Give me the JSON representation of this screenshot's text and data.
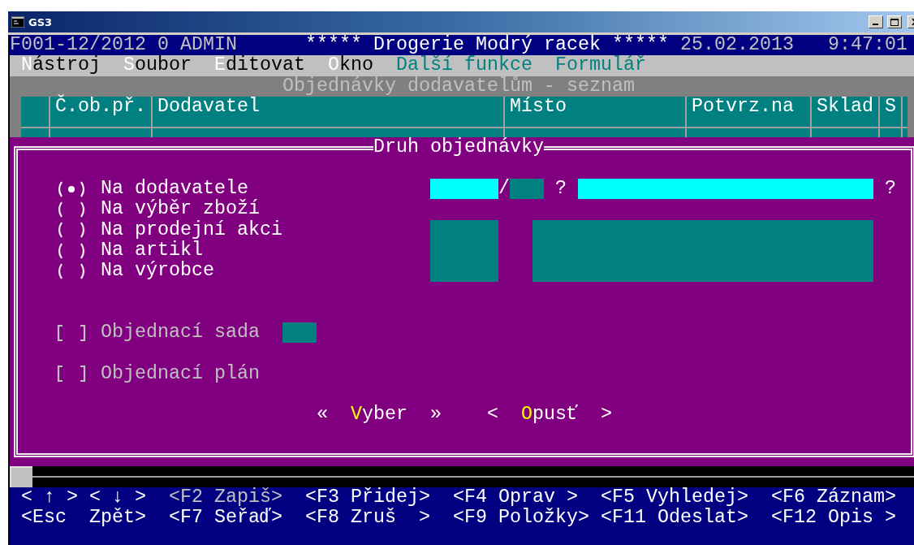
{
  "window": {
    "title": "GS3"
  },
  "header": {
    "session": "F001-12/2012 0 ADMIN",
    "company": "***** Drogerie Modrý racek *****",
    "date": "25.02.2013",
    "time": "9:47:01"
  },
  "menu": [
    {
      "label": "Nástroj",
      "disabled": false
    },
    {
      "label": "Soubor",
      "disabled": false
    },
    {
      "label": "Editovat",
      "disabled": false
    },
    {
      "label": "Okno",
      "disabled": false
    },
    {
      "label": "Další funkce",
      "disabled": true
    },
    {
      "label": "Formulář",
      "disabled": true
    }
  ],
  "screen_title": "Objednávky dodavatelům - seznam",
  "table": {
    "columns": [
      "Č.ob.př.",
      "Dodavatel",
      "Místo",
      "Potvrz.na",
      "Sklad",
      "S"
    ]
  },
  "dialog": {
    "title": "Druh objednávky",
    "options": [
      {
        "label": "Na dodavatele",
        "selected": true
      },
      {
        "label": "Na výběr zboží",
        "selected": false
      },
      {
        "label": "Na prodejní akci",
        "selected": false
      },
      {
        "label": "Na artikl",
        "selected": false
      },
      {
        "label": "Na výrobce",
        "selected": false
      }
    ],
    "supplier_fields": [
      {
        "kind": "field",
        "enabled": true
      },
      {
        "kind": "separator",
        "text": "/"
      },
      {
        "kind": "field",
        "enabled": false
      },
      {
        "kind": "lookup",
        "text": "?"
      },
      {
        "kind": "field",
        "enabled": true
      },
      {
        "kind": "lookup",
        "text": "?"
      }
    ],
    "detail_fields": [
      {
        "enabled": false
      },
      {
        "enabled": false
      }
    ],
    "checkboxes": [
      {
        "label": "Objednací sada",
        "checked": false,
        "disabled": true,
        "field": {
          "enabled": false
        }
      },
      {
        "label": "Objednací plán",
        "checked": false,
        "disabled": true
      }
    ],
    "buttons": [
      {
        "open": "«",
        "label": "Vyber",
        "close": "»"
      },
      {
        "open": "<",
        "label": "Opusť",
        "close": ">"
      }
    ]
  },
  "function_keys": [
    [
      {
        "label": "< ↑ >",
        "disabled": false
      },
      {
        "label": "< ↓ >",
        "disabled": false
      },
      {
        "label": "<F2 Zapiš>",
        "disabled": true
      },
      {
        "label": "<F3 Přidej>",
        "disabled": false
      },
      {
        "label": "<F4 Oprav >",
        "disabled": false
      },
      {
        "label": "<F5 Vyhledej>",
        "disabled": false
      },
      {
        "label": "<F6 Záznam>",
        "disabled": false
      }
    ],
    [
      {
        "label": "<Esc  Zpět>",
        "disabled": false
      },
      {
        "label": "<F7 Seřaď>",
        "disabled": false
      },
      {
        "label": "<F8 Zruš  >",
        "disabled": false
      },
      {
        "label": "<F9 Položky>",
        "disabled": false
      },
      {
        "label": "<F11 Odeslat>",
        "disabled": false
      },
      {
        "label": "<F12 Opis >",
        "disabled": false
      }
    ]
  ]
}
